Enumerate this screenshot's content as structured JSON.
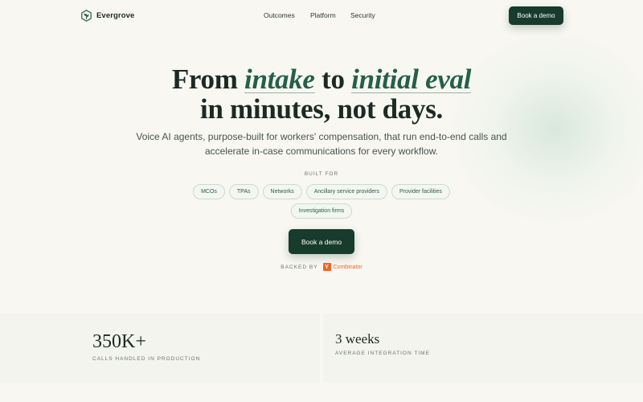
{
  "brand": {
    "name": "Evergrove",
    "logo_icon": "leaf-logo-icon",
    "accent": "#24604a",
    "dark": "#173b2c"
  },
  "nav": {
    "links": [
      "Outcomes",
      "Platform",
      "Security"
    ],
    "cta_label": "Book a demo"
  },
  "hero": {
    "headline": {
      "part1": "From ",
      "em1": "intake",
      "part2": " to ",
      "em2": "initial eval",
      "line2": "in minutes, not days."
    },
    "subheadline": "Voice AI agents, purpose-built for workers' compensation, that run end-to-end calls and accelerate in-case communications for every workflow.",
    "built_for_label": "BUILT FOR",
    "chips": [
      "MCOs",
      "TPAs",
      "Networks",
      "Ancillary service providers",
      "Provider facilities",
      "Investigation firms"
    ],
    "cta_label": "Book a demo",
    "backed_by_label": "BACKED BY",
    "backer": {
      "logo_letter": "Y",
      "name": "Combinator",
      "color": "#f26522"
    }
  },
  "stats": [
    {
      "value": "350K+",
      "label": "CALLS HANDLED IN PRODUCTION"
    },
    {
      "value": "3 weeks",
      "label": "AVERAGE INTEGRATION TIME"
    }
  ]
}
